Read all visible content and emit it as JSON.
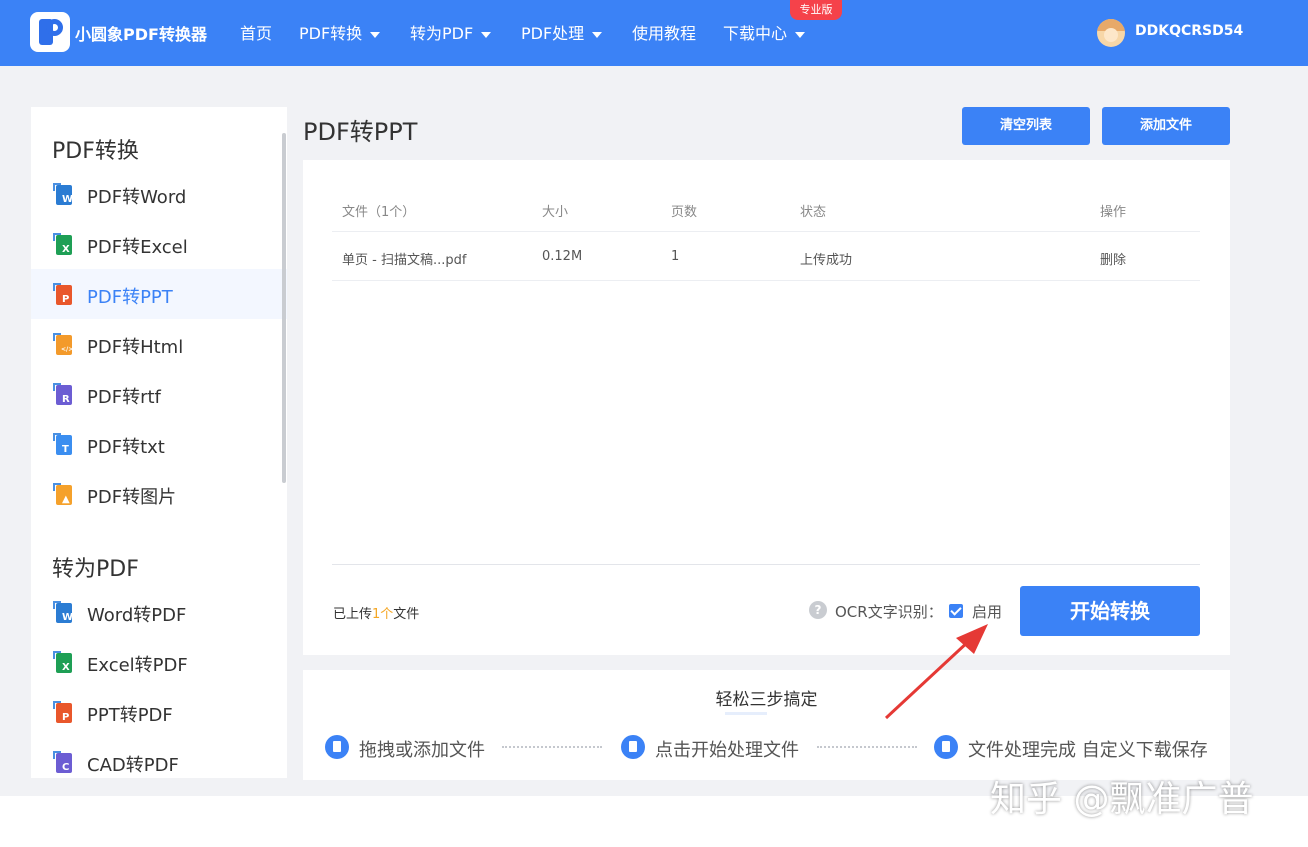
{
  "header": {
    "brand": "小圆象PDF转换器",
    "nav": [
      "首页",
      "PDF转换",
      "转为PDF",
      "PDF处理",
      "使用教程",
      "下载中心"
    ],
    "pro_badge": "专业版",
    "username": "DDKQCRSD54"
  },
  "sidebar": {
    "section1_title": "PDF转换",
    "section1_items": [
      {
        "label": "PDF转Word",
        "icon": "word-doc-icon",
        "color": "#2b7cd3",
        "letter": "W"
      },
      {
        "label": "PDF转Excel",
        "icon": "excel-doc-icon",
        "color": "#1e9f55",
        "letter": "X"
      },
      {
        "label": "PDF转PPT",
        "icon": "ppt-doc-icon",
        "color": "#e9572b",
        "letter": "P"
      },
      {
        "label": "PDF转Html",
        "icon": "html-doc-icon",
        "color": "#f39a2b",
        "letter": "</>"
      },
      {
        "label": "PDF转rtf",
        "icon": "rtf-doc-icon",
        "color": "#6c5dd3",
        "letter": "R"
      },
      {
        "label": "PDF转txt",
        "icon": "txt-doc-icon",
        "color": "#3b8ef0",
        "letter": "T"
      },
      {
        "label": "PDF转图片",
        "icon": "image-doc-icon",
        "color": "#f5a12b",
        "letter": "▲"
      }
    ],
    "section2_title": "转为PDF",
    "section2_items": [
      {
        "label": "Word转PDF",
        "icon": "word-doc-icon",
        "color": "#2b7cd3",
        "letter": "W"
      },
      {
        "label": "Excel转PDF",
        "icon": "excel-doc-icon",
        "color": "#1e9f55",
        "letter": "X"
      },
      {
        "label": "PPT转PDF",
        "icon": "ppt-doc-icon",
        "color": "#e9572b",
        "letter": "P"
      },
      {
        "label": "CAD转PDF",
        "icon": "cad-doc-icon",
        "color": "#6c5dd3",
        "letter": "C"
      }
    ],
    "active_item": "PDF转PPT"
  },
  "main": {
    "title": "PDF转PPT",
    "clear_button": "清空列表",
    "add_button": "添加文件",
    "table": {
      "headers": [
        "文件（1个）",
        "大小",
        "页数",
        "状态",
        "操作"
      ],
      "rows": [
        [
          "单页 - 扫描文稿...pdf",
          "0.12M",
          "1",
          "上传成功",
          "删除"
        ]
      ]
    },
    "uploaded_prefix": "已上传",
    "uploaded_count": "1个",
    "uploaded_suffix": "文件",
    "help_icon": "?",
    "ocr_label": "OCR文字识别：",
    "ocr_enabled": true,
    "enable_label": "启用",
    "start_button": "开始转换"
  },
  "steps": {
    "title": "轻松三步搞定",
    "items": [
      "拖拽或添加文件",
      "点击开始处理文件",
      "文件处理完成 自定义下载保存"
    ]
  },
  "annotation": {
    "arrow_color": "#e53935"
  },
  "watermark": "知乎 @飘准广普"
}
